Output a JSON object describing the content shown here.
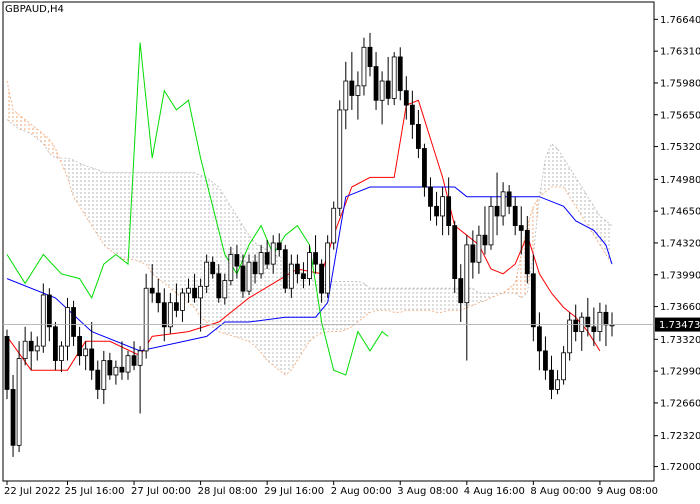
{
  "chart_data": {
    "type": "candlestick",
    "symbol_label": "GBPAUD,H4",
    "current_price_label": "1.73473",
    "ylim": [
      1.7185,
      1.7682
    ],
    "y_ticks": [
      "1.76640",
      "1.76310",
      "1.75980",
      "1.75650",
      "1.75320",
      "1.74980",
      "1.74650",
      "1.74320",
      "1.73990",
      "1.73660",
      "1.73320",
      "1.72990",
      "1.72660",
      "1.72320",
      "1.72000"
    ],
    "x_ticks": [
      "22 Jul 2022",
      "25 Jul 16:00",
      "27 Jul 00:00",
      "28 Jul 08:00",
      "29 Jul 16:00",
      "2 Aug 00:00",
      "3 Aug 08:00",
      "4 Aug 16:00",
      "8 Aug 00:00",
      "9 Aug 08:00"
    ],
    "bar_count": 101,
    "candles": [
      [
        1.7335,
        1.7342,
        1.727,
        1.728
      ],
      [
        1.728,
        1.7295,
        1.721,
        1.7222
      ],
      [
        1.7222,
        1.733,
        1.7215,
        1.7312
      ],
      [
        1.7312,
        1.7345,
        1.7305,
        1.733
      ],
      [
        1.733,
        1.734,
        1.73,
        1.732
      ],
      [
        1.732,
        1.7335,
        1.731,
        1.7325
      ],
      [
        1.7325,
        1.739,
        1.7318,
        1.7378
      ],
      [
        1.7378,
        1.7385,
        1.733,
        1.7345
      ],
      [
        1.7345,
        1.735,
        1.73,
        1.731
      ],
      [
        1.731,
        1.733,
        1.7298,
        1.7325
      ],
      [
        1.7325,
        1.7375,
        1.731,
        1.7365
      ],
      [
        1.7365,
        1.7372,
        1.7325,
        1.7335
      ],
      [
        1.7335,
        1.7345,
        1.7305,
        1.7315
      ],
      [
        1.7315,
        1.733,
        1.73,
        1.7322
      ],
      [
        1.7322,
        1.735,
        1.729,
        1.73
      ],
      [
        1.73,
        1.731,
        1.727,
        1.728
      ],
      [
        1.728,
        1.732,
        1.7265,
        1.731
      ],
      [
        1.731,
        1.7318,
        1.729,
        1.7295
      ],
      [
        1.7295,
        1.731,
        1.7285,
        1.7303
      ],
      [
        1.7303,
        1.733,
        1.729,
        1.7298
      ],
      [
        1.7298,
        1.732,
        1.729,
        1.7315
      ],
      [
        1.7315,
        1.733,
        1.73,
        1.7305
      ],
      [
        1.7305,
        1.7325,
        1.7255,
        1.732
      ],
      [
        1.732,
        1.74,
        1.7312,
        1.7385
      ],
      [
        1.7385,
        1.741,
        1.737,
        1.738
      ],
      [
        1.738,
        1.7395,
        1.736,
        1.737
      ],
      [
        1.737,
        1.7385,
        1.733,
        1.7345
      ],
      [
        1.7345,
        1.738,
        1.7338,
        1.737
      ],
      [
        1.737,
        1.739,
        1.7355,
        1.7362
      ],
      [
        1.7362,
        1.7385,
        1.735,
        1.738
      ],
      [
        1.738,
        1.7395,
        1.737,
        1.7385
      ],
      [
        1.7385,
        1.74,
        1.737,
        1.7375
      ],
      [
        1.7375,
        1.7395,
        1.734,
        1.7387
      ],
      [
        1.7387,
        1.742,
        1.738,
        1.7412
      ],
      [
        1.7412,
        1.7418,
        1.7395,
        1.74
      ],
      [
        1.74,
        1.741,
        1.737,
        1.7375
      ],
      [
        1.7375,
        1.74,
        1.7368,
        1.7393
      ],
      [
        1.7393,
        1.7428,
        1.7388,
        1.742
      ],
      [
        1.742,
        1.743,
        1.7395,
        1.7408
      ],
      [
        1.7408,
        1.742,
        1.7375,
        1.7382
      ],
      [
        1.7382,
        1.742,
        1.7378,
        1.7412
      ],
      [
        1.7412,
        1.742,
        1.739,
        1.74
      ],
      [
        1.74,
        1.743,
        1.7395,
        1.7422
      ],
      [
        1.7422,
        1.7435,
        1.7405,
        1.741
      ],
      [
        1.741,
        1.744,
        1.74,
        1.7432
      ],
      [
        1.7432,
        1.7442,
        1.7418,
        1.7425
      ],
      [
        1.7425,
        1.743,
        1.738,
        1.7385
      ],
      [
        1.7385,
        1.742,
        1.7375,
        1.741
      ],
      [
        1.741,
        1.742,
        1.739,
        1.74
      ],
      [
        1.74,
        1.7412,
        1.7385,
        1.7395
      ],
      [
        1.7395,
        1.743,
        1.7388,
        1.7422
      ],
      [
        1.7422,
        1.744,
        1.74,
        1.741
      ],
      [
        1.741,
        1.7415,
        1.737,
        1.738
      ],
      [
        1.738,
        1.744,
        1.7375,
        1.7432
      ],
      [
        1.7432,
        1.7475,
        1.7425,
        1.7468
      ],
      [
        1.7468,
        1.758,
        1.746,
        1.757
      ],
      [
        1.757,
        1.762,
        1.755,
        1.76
      ],
      [
        1.76,
        1.763,
        1.757,
        1.7585
      ],
      [
        1.7585,
        1.761,
        1.756,
        1.7595
      ],
      [
        1.7595,
        1.7645,
        1.7585,
        1.7635
      ],
      [
        1.7635,
        1.765,
        1.7605,
        1.7615
      ],
      [
        1.7615,
        1.763,
        1.757,
        1.758
      ],
      [
        1.758,
        1.761,
        1.7555,
        1.76
      ],
      [
        1.76,
        1.7625,
        1.7575,
        1.7582
      ],
      [
        1.7582,
        1.763,
        1.7575,
        1.7625
      ],
      [
        1.7625,
        1.7635,
        1.758,
        1.759
      ],
      [
        1.759,
        1.7605,
        1.756,
        1.7575
      ],
      [
        1.7575,
        1.759,
        1.754,
        1.7555
      ],
      [
        1.7555,
        1.757,
        1.752,
        1.753
      ],
      [
        1.753,
        1.7535,
        1.748,
        1.749
      ],
      [
        1.749,
        1.75,
        1.7455,
        1.747
      ],
      [
        1.747,
        1.7485,
        1.745,
        1.746
      ],
      [
        1.746,
        1.749,
        1.744,
        1.748
      ],
      [
        1.748,
        1.75,
        1.744,
        1.745
      ],
      [
        1.745,
        1.7455,
        1.738,
        1.7395
      ],
      [
        1.7395,
        1.741,
        1.735,
        1.737
      ],
      [
        1.737,
        1.744,
        1.731,
        1.743
      ],
      [
        1.743,
        1.7445,
        1.7395,
        1.7412
      ],
      [
        1.7412,
        1.745,
        1.74,
        1.744
      ],
      [
        1.744,
        1.747,
        1.742,
        1.743
      ],
      [
        1.743,
        1.748,
        1.7425,
        1.747
      ],
      [
        1.747,
        1.7505,
        1.744,
        1.746
      ],
      [
        1.746,
        1.7495,
        1.745,
        1.7485
      ],
      [
        1.7485,
        1.7492,
        1.7462,
        1.747
      ],
      [
        1.747,
        1.748,
        1.744,
        1.745
      ],
      [
        1.745,
        1.747,
        1.742,
        1.7445
      ],
      [
        1.7445,
        1.746,
        1.739,
        1.74
      ],
      [
        1.74,
        1.742,
        1.733,
        1.7345
      ],
      [
        1.7345,
        1.736,
        1.73,
        1.732
      ],
      [
        1.732,
        1.7335,
        1.729,
        1.73
      ],
      [
        1.73,
        1.7315,
        1.727,
        1.728
      ],
      [
        1.728,
        1.73,
        1.7275,
        1.729
      ],
      [
        1.729,
        1.7325,
        1.7285,
        1.7318
      ],
      [
        1.7318,
        1.736,
        1.731,
        1.7352
      ],
      [
        1.7352,
        1.7368,
        1.733,
        1.734
      ],
      [
        1.734,
        1.736,
        1.732,
        1.7355
      ],
      [
        1.7355,
        1.7375,
        1.7335,
        1.7345
      ],
      [
        1.7345,
        1.7365,
        1.7325,
        1.734
      ],
      [
        1.734,
        1.737,
        1.733,
        1.736
      ],
      [
        1.736,
        1.7368,
        1.7325,
        1.7347
      ],
      [
        1.7347,
        1.736,
        1.7335,
        1.7347
      ]
    ],
    "series": [
      {
        "key": "tenkan",
        "color": "#ff0000",
        "points": [
          [
            0,
            1.7335
          ],
          [
            4,
            1.73
          ],
          [
            10,
            1.73
          ],
          [
            13,
            1.733
          ],
          [
            17,
            1.733
          ],
          [
            22,
            1.7315
          ],
          [
            24,
            1.7335
          ],
          [
            30,
            1.734
          ],
          [
            35,
            1.735
          ],
          [
            40,
            1.7375
          ],
          [
            44,
            1.739
          ],
          [
            48,
            1.7405
          ],
          [
            52,
            1.74
          ],
          [
            54,
            1.744
          ],
          [
            57,
            1.749
          ],
          [
            60,
            1.75
          ],
          [
            64,
            1.75
          ],
          [
            66,
            1.7575
          ],
          [
            68,
            1.758
          ],
          [
            70,
            1.754
          ],
          [
            72,
            1.75
          ],
          [
            74,
            1.745
          ],
          [
            76,
            1.744
          ],
          [
            78,
            1.743
          ],
          [
            80,
            1.7405
          ],
          [
            82,
            1.74
          ],
          [
            84,
            1.741
          ],
          [
            86,
            1.744
          ],
          [
            88,
            1.74
          ],
          [
            90,
            1.738
          ],
          [
            92,
            1.7365
          ],
          [
            94,
            1.7355
          ],
          [
            96,
            1.734
          ],
          [
            98,
            1.732
          ]
        ]
      },
      {
        "key": "kijun",
        "color": "#0000ff",
        "points": [
          [
            0,
            1.7395
          ],
          [
            8,
            1.7375
          ],
          [
            14,
            1.734
          ],
          [
            22,
            1.732
          ],
          [
            33,
            1.7335
          ],
          [
            36,
            1.735
          ],
          [
            40,
            1.735
          ],
          [
            46,
            1.7355
          ],
          [
            51,
            1.7355
          ],
          [
            53,
            1.737
          ],
          [
            56,
            1.748
          ],
          [
            60,
            1.749
          ],
          [
            74,
            1.749
          ],
          [
            76,
            1.748
          ],
          [
            88,
            1.748
          ],
          [
            92,
            1.747
          ],
          [
            94,
            1.7455
          ],
          [
            97,
            1.7445
          ],
          [
            99,
            1.743
          ],
          [
            100,
            1.741
          ]
        ]
      },
      {
        "key": "chikou",
        "color": "#00dd00",
        "points": [
          [
            0,
            1.742
          ],
          [
            3,
            1.739
          ],
          [
            6,
            1.742
          ],
          [
            9,
            1.74
          ],
          [
            12,
            1.7395
          ],
          [
            14,
            1.7375
          ],
          [
            16,
            1.741
          ],
          [
            18,
            1.742
          ],
          [
            20,
            1.741
          ],
          [
            22,
            1.764
          ],
          [
            24,
            1.752
          ],
          [
            26,
            1.759
          ],
          [
            28,
            1.757
          ],
          [
            30,
            1.758
          ],
          [
            32,
            1.752
          ],
          [
            34,
            1.747
          ],
          [
            36,
            1.742
          ],
          [
            38,
            1.74
          ],
          [
            40,
            1.743
          ],
          [
            42,
            1.745
          ],
          [
            44,
            1.742
          ],
          [
            46,
            1.744
          ],
          [
            48,
            1.745
          ],
          [
            50,
            1.743
          ],
          [
            51,
            1.739
          ],
          [
            52,
            1.735
          ],
          [
            54,
            1.73
          ],
          [
            56,
            1.7295
          ],
          [
            58,
            1.734
          ],
          [
            60,
            1.732
          ],
          [
            62,
            1.734
          ],
          [
            63,
            1.7335
          ]
        ]
      }
    ],
    "cloud": {
      "start_index": 0,
      "span_a": [
        1.76,
        1.757,
        1.7565,
        1.756,
        1.7555,
        1.755,
        1.7545,
        1.754,
        1.753,
        1.7515,
        1.75,
        1.748,
        1.747,
        1.746,
        1.745,
        1.744,
        1.743,
        1.7425,
        1.742,
        1.7415,
        1.7415,
        1.7415,
        1.7412,
        1.741,
        1.74,
        1.7395,
        1.739,
        1.7385,
        1.738,
        1.7375,
        1.737,
        1.7365,
        1.7355,
        1.735,
        1.7345,
        1.734,
        1.7338,
        1.7336,
        1.7334,
        1.7332,
        1.733,
        1.7325,
        1.7318,
        1.731,
        1.7305,
        1.73,
        1.7295,
        1.73,
        1.731,
        1.732,
        1.733,
        1.7335,
        1.7338,
        1.734,
        1.734,
        1.734,
        1.7342,
        1.7345,
        1.735,
        1.7355,
        1.736,
        1.7362,
        1.7362,
        1.7362,
        1.736,
        1.736,
        1.7362,
        1.7362,
        1.7362,
        1.7362,
        1.7362,
        1.736,
        1.736,
        1.7362,
        1.7362,
        1.7362,
        1.7365,
        1.7367,
        1.737,
        1.7372,
        1.7375,
        1.7378,
        1.738,
        1.7385,
        1.739,
        1.742,
        1.745,
        1.747,
        1.748,
        1.7485,
        1.749,
        1.749,
        1.749,
        1.748,
        1.747,
        1.746,
        1.745,
        1.744,
        1.743,
        1.742,
        1.741
      ],
      "span_b": [
        1.756,
        1.7555,
        1.755,
        1.7548,
        1.7545,
        1.754,
        1.7535,
        1.7525,
        1.752,
        1.752,
        1.752,
        1.7518,
        1.7515,
        1.7512,
        1.751,
        1.7508,
        1.7505,
        1.7505,
        1.7505,
        1.7505,
        1.7505,
        1.7505,
        1.7505,
        1.7505,
        1.7505,
        1.7505,
        1.7505,
        1.7505,
        1.7505,
        1.7505,
        1.7505,
        1.7505,
        1.7502,
        1.75,
        1.7495,
        1.749,
        1.748,
        1.747,
        1.746,
        1.745,
        1.744,
        1.7432,
        1.7428,
        1.7425,
        1.742,
        1.7418,
        1.7415,
        1.741,
        1.7405,
        1.74,
        1.7395,
        1.7392,
        1.7392,
        1.7392,
        1.7392,
        1.7392,
        1.7392,
        1.7392,
        1.7392,
        1.739,
        1.7385,
        1.7385,
        1.7385,
        1.7385,
        1.7385,
        1.7385,
        1.7385,
        1.7385,
        1.7385,
        1.7385,
        1.7385,
        1.7385,
        1.7385,
        1.7385,
        1.7385,
        1.7385,
        1.7385,
        1.7385,
        1.738,
        1.738,
        1.738,
        1.738,
        1.738,
        1.738,
        1.738,
        1.7375,
        1.738,
        1.742,
        1.748,
        1.752,
        1.7535,
        1.753,
        1.752,
        1.751,
        1.75,
        1.749,
        1.748,
        1.747,
        1.746,
        1.7455,
        1.745
      ]
    },
    "colors": {
      "background": "#ffffff",
      "axis": "#000000",
      "cloud_bull": "#f4a470",
      "cloud_bear": "#b8b8b8",
      "candle_bull_body": "#ffffff",
      "candle_bear_body": "#000000",
      "price_line": "#b0b0b0"
    },
    "grid": false
  }
}
